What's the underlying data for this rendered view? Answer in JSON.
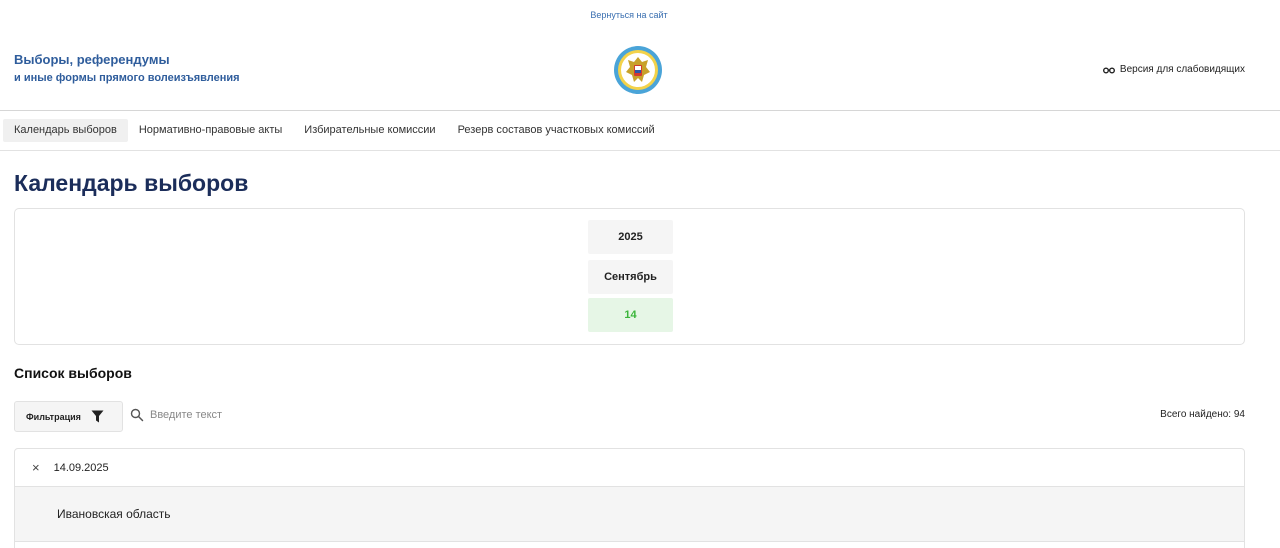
{
  "header": {
    "back_link": "Вернуться на сайт",
    "title_line1": "Выборы, референдумы",
    "title_line2": "и иные формы прямого волеизъявления",
    "low_vision_label": "Версия для слабовидящих"
  },
  "nav": {
    "items": [
      {
        "label": "Календарь выборов",
        "active": true
      },
      {
        "label": "Нормативно-правовые акты"
      },
      {
        "label": "Избирательные комиссии"
      },
      {
        "label": "Резерв составов участковых комиссий"
      }
    ]
  },
  "main": {
    "page_title": "Календарь выборов",
    "calendar": {
      "year": "2025",
      "month": "Сентябрь",
      "day": "14"
    },
    "list_title": "Список выборов",
    "filter_label": "Фильтрация",
    "search_placeholder": "Введите текст",
    "total_found": "Всего найдено: 94",
    "results": {
      "date": "14.09.2025",
      "close_symbol": "×",
      "region": "Ивановская область"
    }
  },
  "colors": {
    "accent": "#2f5d9c",
    "title": "#1b2d5a",
    "active_day_bg": "#e6f6e6",
    "active_day_text": "#3ab53a"
  },
  "icons": [
    "glasses-icon",
    "emblem-icon",
    "filter-icon",
    "search-icon",
    "close-icon"
  ]
}
